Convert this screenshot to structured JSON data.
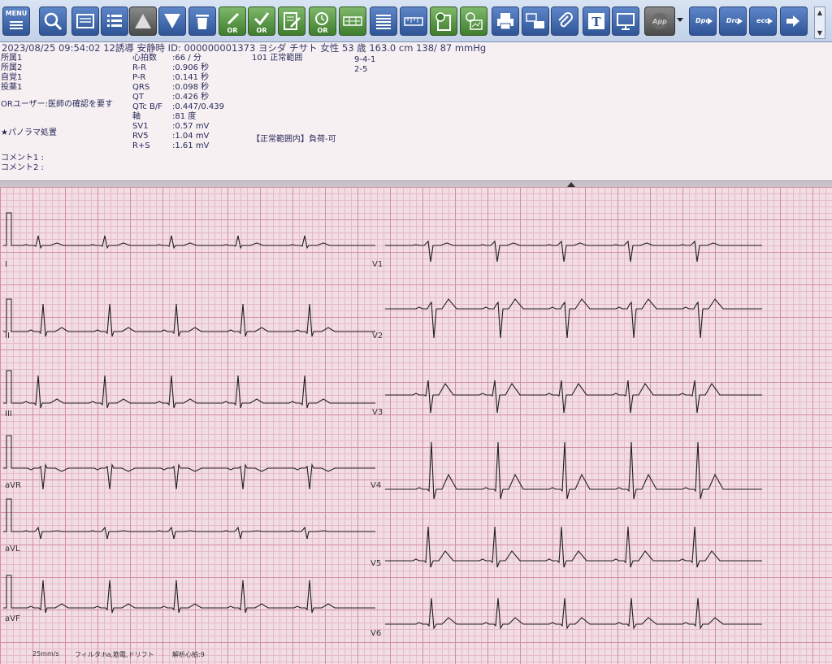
{
  "toolbar": {
    "menu_label": "MENU",
    "app_label": "App",
    "dpq1_label": "Dpq",
    "dpq2_label": "Drq",
    "eco_label": "eco",
    "or_label": "OR",
    "text_label": "T",
    "buttons": [
      {
        "icon": "menu-icon"
      },
      {
        "icon": "search-icon"
      },
      {
        "icon": "card-icon"
      },
      {
        "icon": "list-icon"
      },
      {
        "icon": "triangle-up-icon"
      },
      {
        "icon": "triangle-down-icon"
      },
      {
        "icon": "trash-icon"
      },
      {
        "icon": "edit-or-icon"
      },
      {
        "icon": "check-or-icon"
      },
      {
        "icon": "document-edit-icon"
      },
      {
        "icon": "clock-or-icon"
      },
      {
        "icon": "grid-compare-icon"
      },
      {
        "icon": "lines-icon"
      },
      {
        "icon": "ruler-icon"
      },
      {
        "icon": "clock-document-icon"
      },
      {
        "icon": "clock-chart-icon"
      },
      {
        "icon": "printer-icon"
      },
      {
        "icon": "transfer-print-icon"
      },
      {
        "icon": "paperclip-icon"
      },
      {
        "icon": "text-icon"
      },
      {
        "icon": "monitor-icon"
      },
      {
        "icon": "app-icon"
      },
      {
        "icon": "dpq-icon"
      },
      {
        "icon": "drq-icon"
      },
      {
        "icon": "eco-icon"
      },
      {
        "icon": "export-icon"
      }
    ]
  },
  "info": {
    "header": "2023/08/25 09:54:02  12誘導  安静時  ID: 000000001373 ヨシダ チサト 女性 53 歳 163.0 cm 138/ 87 mmHg",
    "left": [
      "所属1",
      "所属2",
      "自覚1",
      "投薬1"
    ],
    "or_user": "ORユーザー:医師の確認を要す",
    "panorama": "★パノラマ処置",
    "comment1": "コメント1 :",
    "comment2": "コメント2 :",
    "measurements": [
      {
        "label": "心拍数",
        "value": ":66 / 分"
      },
      {
        "label": "R-R",
        "value": ":0.906 秒"
      },
      {
        "label": "P-R",
        "value": ":0.141 秒"
      },
      {
        "label": "QRS",
        "value": ":0.098 秒"
      },
      {
        "label": "QT",
        "value": ":0.426 秒"
      },
      {
        "label": "QTc B/F",
        "value": ":0.447/0.439"
      },
      {
        "label": "軸",
        "value": ":81 度"
      },
      {
        "label": "SV1",
        "value": ":0.57 mV"
      },
      {
        "label": "RV5",
        "value": ":1.04 mV"
      },
      {
        "label": "R+S",
        "value": ":1.61 mV"
      }
    ],
    "finding_code": "101 正常範囲",
    "codes": [
      "9-4-1",
      "2-5"
    ],
    "summary": "【正常範囲内】負荷-可"
  },
  "ecg": {
    "leads_left": [
      "I",
      "II",
      "III",
      "aVR",
      "aVL",
      "aVF"
    ],
    "leads_right": [
      "V1",
      "V2",
      "V3",
      "V4",
      "V5",
      "V6"
    ]
  },
  "footer": {
    "speed": "25mm/s",
    "filter": "フィルタ:ha,筋電,ドリフト",
    "beats": "解析心拍:9"
  }
}
